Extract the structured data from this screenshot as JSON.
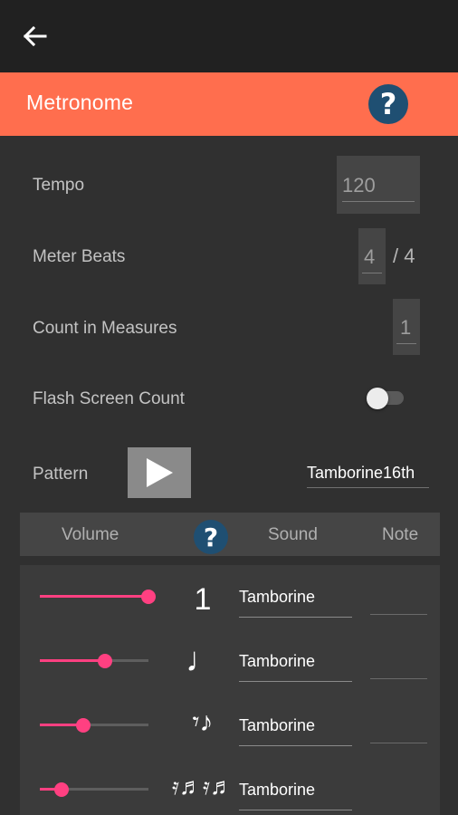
{
  "header": {
    "title": "Metronome"
  },
  "settings": {
    "tempo": {
      "label": "Tempo",
      "value": "120"
    },
    "meter": {
      "label": "Meter Beats",
      "value": "4",
      "denominator": "/ 4"
    },
    "count_in": {
      "label": "Count in Measures",
      "value": "1"
    },
    "flash": {
      "label": "Flash Screen Count",
      "enabled": false
    }
  },
  "pattern": {
    "label": "Pattern",
    "value": "Tamborine16th"
  },
  "columns": {
    "volume": "Volume",
    "sound": "Sound",
    "note": "Note"
  },
  "tracks": [
    {
      "volume": 1.0,
      "note_glyph": "1",
      "sound": "Tamborine"
    },
    {
      "volume": 0.6,
      "note_glyph": "♩",
      "sound": "Tamborine"
    },
    {
      "volume": 0.4,
      "note_glyph": "𝄾♪",
      "sound": "Tamborine"
    },
    {
      "volume": 0.2,
      "note_glyph": "𝄿♬𝄿♬",
      "sound": "Tamborine"
    }
  ],
  "colors": {
    "accent": "#ff6e4e",
    "slider": "#ff4081",
    "help": "#1f4f72"
  }
}
